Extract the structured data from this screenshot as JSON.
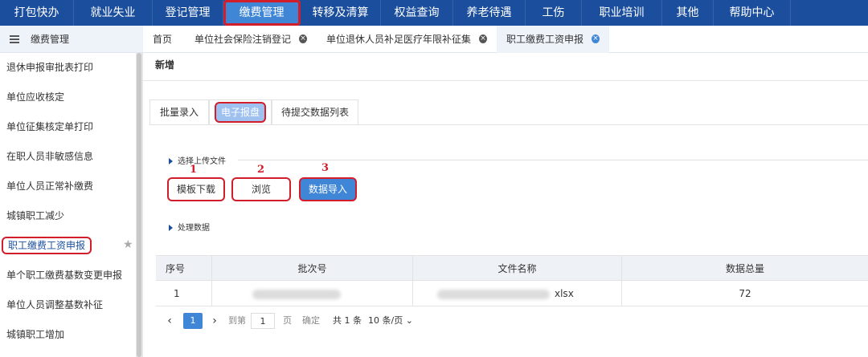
{
  "topnav": {
    "items": [
      {
        "label": "打包快办"
      },
      {
        "label": "就业失业"
      },
      {
        "label": "登记管理"
      },
      {
        "label": "缴费管理"
      },
      {
        "label": "转移及清算"
      },
      {
        "label": "权益查询"
      },
      {
        "label": "养老待遇"
      },
      {
        "label": "工伤"
      },
      {
        "label": "职业培训"
      },
      {
        "label": "其他"
      },
      {
        "label": "帮助中心"
      }
    ],
    "active_index": 3
  },
  "sidebar": {
    "title": "缴费管理",
    "items": [
      {
        "label": "退休申报审批表打印"
      },
      {
        "label": "单位应收核定"
      },
      {
        "label": "单位征集核定单打印"
      },
      {
        "label": "在职人员非敏感信息"
      },
      {
        "label": "单位人员正常补缴费"
      },
      {
        "label": "城镇职工减少"
      },
      {
        "label": "职工缴费工资申报"
      },
      {
        "label": "单个职工缴费基数变更申报"
      },
      {
        "label": "单位人员调整基数补征"
      },
      {
        "label": "城镇职工增加"
      }
    ],
    "active_index": 6
  },
  "tabs": [
    {
      "label": "首页",
      "closable": false
    },
    {
      "label": "单位社会保险注销登记",
      "closable": true
    },
    {
      "label": "单位退休人员补足医疗年限补征集",
      "closable": true
    },
    {
      "label": "职工缴费工资申报",
      "closable": true
    }
  ],
  "main": {
    "section_title": "新增",
    "subtabs": [
      {
        "label": "批量录入"
      },
      {
        "label": "电子报盘"
      },
      {
        "label": "待提交数据列表"
      }
    ],
    "upload_group": {
      "title": "选择上传文件",
      "annotations": [
        "1",
        "2",
        "3"
      ],
      "buttons": {
        "template_download": "模板下载",
        "browse": "浏览",
        "data_import": "数据导入"
      }
    },
    "process_group": {
      "title": "处理数据"
    },
    "table": {
      "headers": [
        "序号",
        "批次号",
        "文件名称",
        "数据总量"
      ],
      "rows": [
        {
          "index": "1",
          "batch": "",
          "filename_suffix": "xlsx",
          "total": "72"
        }
      ]
    },
    "pager": {
      "current_page": "1",
      "goto_label": "到第",
      "page_input": "1",
      "page_unit": "页",
      "confirm": "确定",
      "total": "共 1 条",
      "page_size": "10 条/页"
    }
  },
  "colors": {
    "nav_bg": "#1b4f9e",
    "accent": "#3f86d6",
    "highlight_red": "#d21e2b"
  }
}
